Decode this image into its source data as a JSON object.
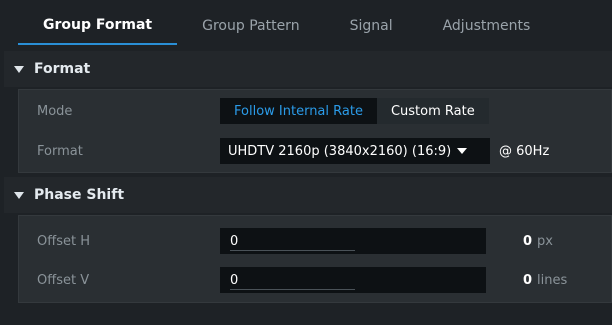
{
  "tabs": [
    {
      "label": "Group Format",
      "active": true
    },
    {
      "label": "Group Pattern",
      "active": false
    },
    {
      "label": "Signal",
      "active": false
    },
    {
      "label": "Adjustments",
      "active": false
    }
  ],
  "format_section": {
    "title": "Format",
    "mode_label": "Mode",
    "mode_options": [
      "Follow Internal Rate",
      "Custom Rate"
    ],
    "mode_selected": "Follow Internal Rate",
    "format_label": "Format",
    "format_value": "UHDTV 2160p (3840x2160) (16:9)",
    "rate": "@ 60Hz"
  },
  "phase_section": {
    "title": "Phase Shift",
    "offset_h": {
      "label": "Offset H",
      "value": "0",
      "readout": "0",
      "unit": "px"
    },
    "offset_v": {
      "label": "Offset V",
      "value": "0",
      "readout": "0",
      "unit": "lines"
    }
  },
  "colors": {
    "accent": "#2a8fd6",
    "background": "#1e2226",
    "panel": "#2a2f33",
    "field": "#0d1114"
  }
}
